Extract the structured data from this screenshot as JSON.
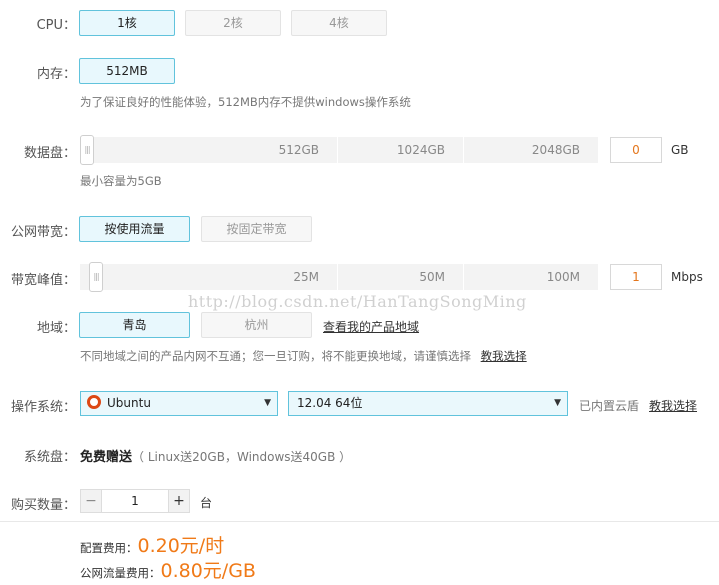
{
  "cpu": {
    "label": "CPU：",
    "options": [
      "1核",
      "2核",
      "4核"
    ]
  },
  "memory": {
    "label": "内存：",
    "value": "512MB",
    "note": "为了保证良好的性能体验，512MB内存不提供windows操作系统"
  },
  "data_disk": {
    "label": "数据盘：",
    "ticks": [
      "512GB",
      "1024GB",
      "2048GB"
    ],
    "value": "0",
    "unit": "GB",
    "note": "最小容量为5GB"
  },
  "bandwidth_type": {
    "label": "公网带宽：",
    "options": [
      "按使用流量",
      "按固定带宽"
    ]
  },
  "bandwidth_peak": {
    "label": "带宽峰值：",
    "ticks": [
      "25M",
      "50M",
      "100M"
    ],
    "value": "1",
    "unit": "Mbps"
  },
  "region": {
    "label": "地域：",
    "options": [
      "青岛",
      "杭州"
    ],
    "my_regions_link": "查看我的产品地域",
    "note": "不同地域之间的产品内网不互通；您一旦订购，将不能更换地域，请谨慎选择",
    "help_link": "教我选择"
  },
  "os": {
    "label": "操作系统：",
    "distro": "Ubuntu",
    "version": "12.04 64位",
    "note": "已内置云盾",
    "help_link": "教我选择"
  },
  "system_disk": {
    "label": "系统盘：",
    "value": "免费赠送",
    "note": "（ Linux送20GB，Windows送40GB ）"
  },
  "quantity": {
    "label": "购买数量：",
    "minus": "−",
    "value": "1",
    "plus": "+",
    "unit": "台"
  },
  "pricing": {
    "config_label": "配置费用：",
    "config_price": "0.20元/时",
    "traffic_label": "公网流量费用：",
    "traffic_price": "0.80元/GB"
  },
  "watermark": "http://blog.csdn.net/HanTangSongMing",
  "colors": {
    "accent_border": "#61c3dc",
    "accent_fill": "#e8f8fd",
    "price": "#f07a18",
    "ubuntu": "#dd4814"
  },
  "icons": {
    "ubuntu": "ubuntu-logo-icon",
    "dropdown": "chevron-down-icon"
  }
}
